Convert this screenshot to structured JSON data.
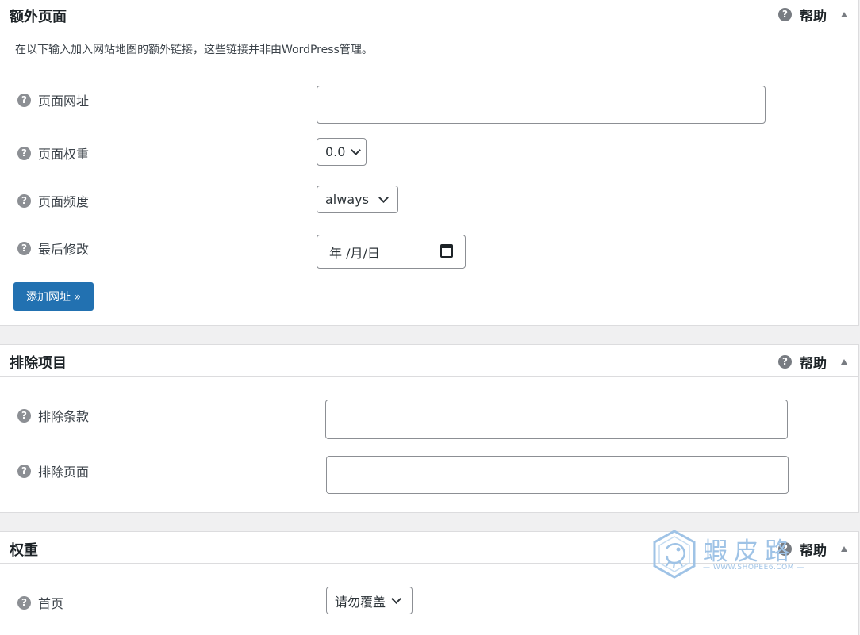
{
  "sections": {
    "extra_pages": {
      "title": "额外页面",
      "help": "帮助",
      "description": "在以下输入加入网站地图的额外链接，这些链接并非由WordPress管理。",
      "fields": {
        "page_url": {
          "label": "页面网址",
          "value": ""
        },
        "page_priority": {
          "label": "页面权重",
          "value": "0.0"
        },
        "page_frequency": {
          "label": "页面频度",
          "value": "always"
        },
        "last_modified": {
          "label": "最后修改",
          "value": "年 /月/日"
        }
      },
      "add_button": "添加网址 »"
    },
    "exclusions": {
      "title": "排除项目",
      "help": "帮助",
      "fields": {
        "exclude_terms": {
          "label": "排除条款",
          "value": ""
        },
        "exclude_pages": {
          "label": "排除页面",
          "value": ""
        }
      }
    },
    "priority": {
      "title": "权重",
      "help": "帮助",
      "fields": {
        "homepage": {
          "label": "首页",
          "value": "请勿覆盖"
        }
      }
    }
  },
  "watermark": {
    "brand": "蝦皮路",
    "url": "— WWW.SHOPEE6.COM —"
  },
  "icons": {
    "help": "question-circle-icon",
    "toggle": "arrow-up-icon",
    "dropdown": "chevron-down-icon",
    "date": "calendar-icon"
  },
  "colors": {
    "button_primary": "#2271b1",
    "panel_border": "#dcdcde",
    "background": "#f0f0f1"
  }
}
